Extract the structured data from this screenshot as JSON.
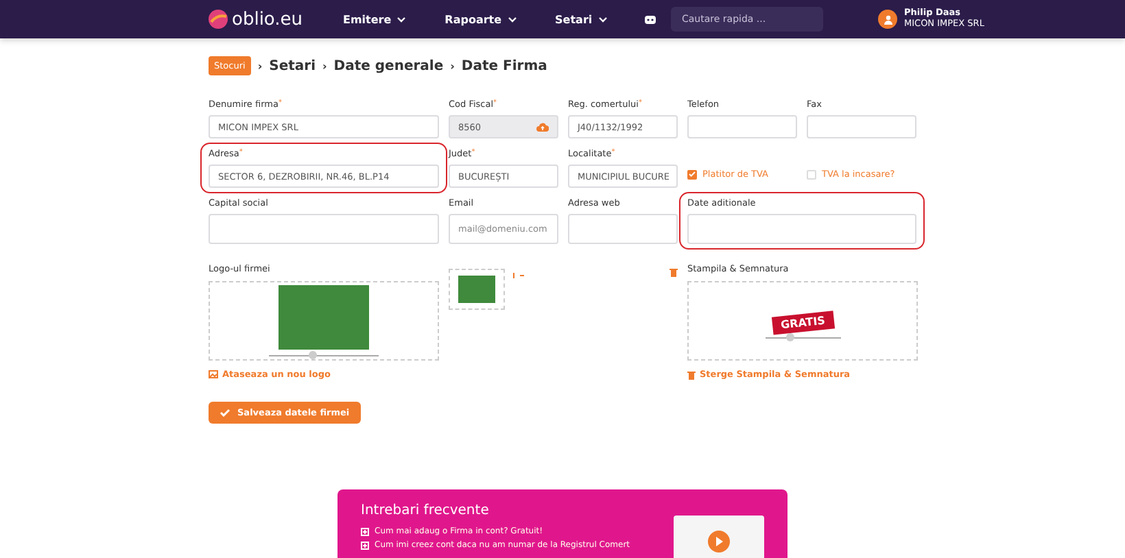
{
  "navbar": {
    "logo": "oblio.eu",
    "menu": [
      {
        "label": "Emitere"
      },
      {
        "label": "Rapoarte"
      },
      {
        "label": "Setari"
      }
    ],
    "search": {
      "placeholder": "Cautare rapida ..."
    },
    "user": {
      "name": "Philip Daas",
      "company": "MICON IMPEX SRL"
    }
  },
  "breadcrumb": {
    "badge": "Stocuri",
    "separator": "›",
    "items": [
      "Setari",
      "Date generale",
      "Date Firma"
    ]
  },
  "form": {
    "required_mark": "*",
    "fields": [
      {
        "kind": "input",
        "label": "Denumire firma",
        "required": true,
        "value": "MICON IMPEX SRL",
        "disabled": false,
        "highlighted": false
      },
      {
        "kind": "input",
        "label": "Cod Fiscal",
        "required": true,
        "value": "8560",
        "disabled": true,
        "highlighted": false
      },
      {
        "kind": "input",
        "label": "Reg. comertului",
        "required": true,
        "value": "J40/1132/1992",
        "disabled": false,
        "highlighted": false
      },
      {
        "kind": "input",
        "label": "Telefon",
        "required": false,
        "disabled": false,
        "highlighted": false
      },
      {
        "kind": "input",
        "label": "Fax",
        "required": false,
        "disabled": false,
        "highlighted": false
      },
      {
        "kind": "input",
        "label": "Adresa",
        "required": true,
        "value": "SECTOR 6,  DEZROBIRII,  NR.46,  BL.P14",
        "disabled": false,
        "highlighted": true
      },
      {
        "kind": "input",
        "label": "Judet",
        "required": true,
        "value": "BUCUREȘTI",
        "disabled": false,
        "highlighted": false
      },
      {
        "kind": "input",
        "label": "Localitate",
        "required": true,
        "value": "MUNICIPIUL BUCURE",
        "disabled": false,
        "highlighted": false
      },
      {
        "kind": "checkbox",
        "label": "Platitor de TVA",
        "checked": true
      },
      {
        "kind": "checkbox",
        "label": "TVA la incasare?",
        "checked": false
      },
      {
        "kind": "input",
        "label": "Capital social",
        "required": false,
        "disabled": false,
        "highlighted": false
      },
      {
        "kind": "input",
        "label": "Email",
        "required": false,
        "placeholder": "mail@domeniu.com",
        "disabled": false,
        "highlighted": false
      },
      {
        "kind": "input",
        "label": "Adresa web",
        "required": false,
        "disabled": false,
        "highlighted": false
      },
      {
        "kind": "textarea",
        "label": "Date aditionale",
        "required": false,
        "disabled": false,
        "highlighted": true
      }
    ]
  },
  "logo": {
    "label": "Logo-ul firmei",
    "slider": {
      "level": 0.4
    },
    "attach_link": "Ataseaza un nou logo"
  },
  "stamp": {
    "label": "Stampila & Semnatura",
    "badge": "GRATIS",
    "slider": {
      "level": 0.33
    },
    "delete_link": "Sterge Stampila & Semnatura"
  },
  "save_button": "Salveaza datele firmei",
  "faq": {
    "title": "Intrebari frecvente",
    "items": [
      "Cum mai adaug o Firma in cont? Gratuit!",
      "Cum imi creez cont daca nu am numar de la Registrul Comert"
    ]
  }
}
